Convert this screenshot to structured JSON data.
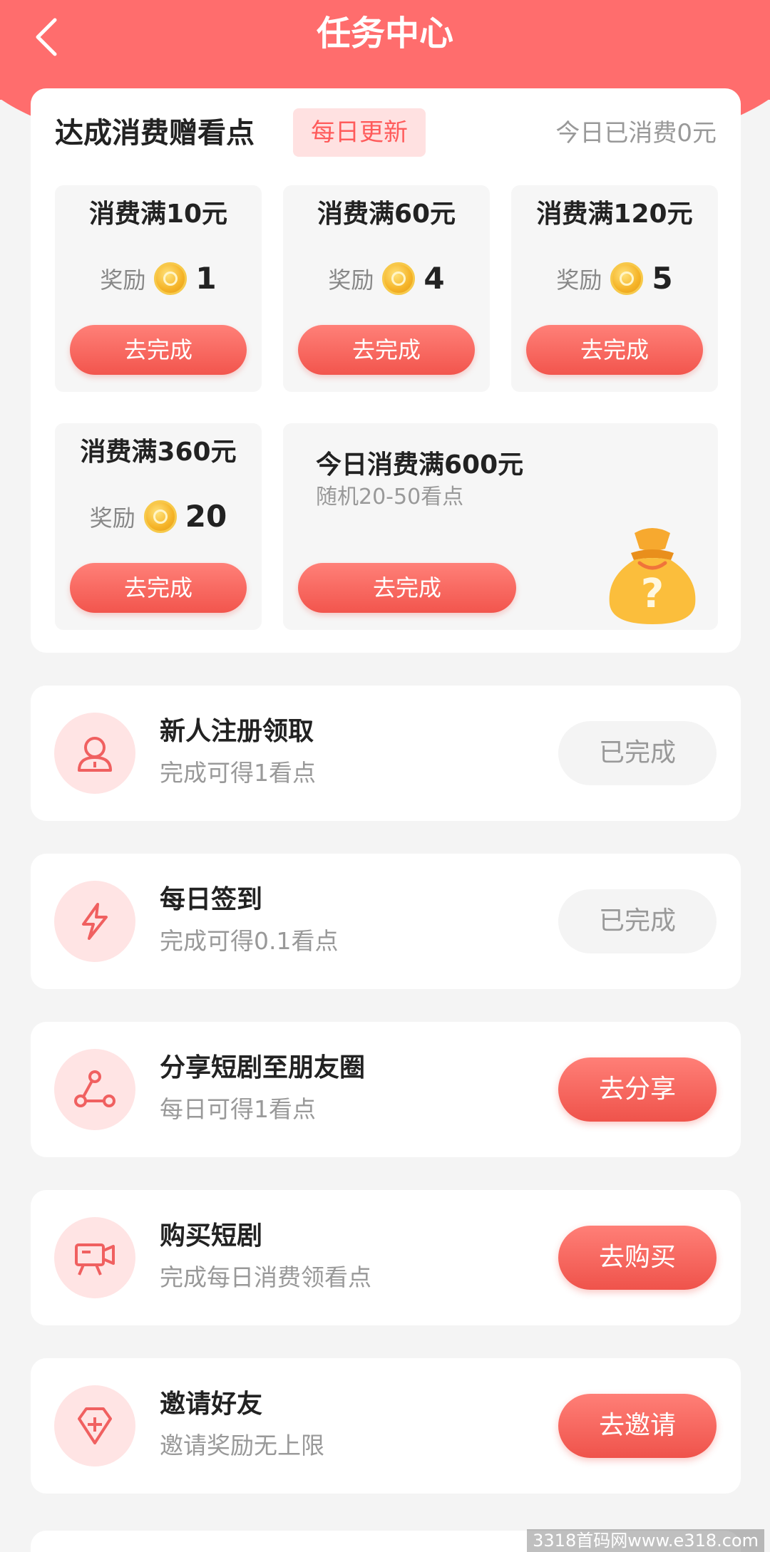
{
  "header": {
    "title": "任务中心"
  },
  "spend_section": {
    "title": "达成消费赠看点",
    "badge": "每日更新",
    "today_spent": "今日已消费0元",
    "reward_label": "奖励",
    "tiers": [
      {
        "title": "消费满10元",
        "reward": "1",
        "button": "去完成"
      },
      {
        "title": "消费满60元",
        "reward": "4",
        "button": "去完成"
      },
      {
        "title": "消费满120元",
        "reward": "5",
        "button": "去完成"
      },
      {
        "title": "消费满360元",
        "reward": "20",
        "button": "去完成"
      }
    ],
    "big_tier": {
      "title": "今日消费满600元",
      "subtitle": "随机20-50看点",
      "button": "去完成"
    }
  },
  "tasks": [
    {
      "title": "新人注册领取",
      "subtitle": "完成可得1看点",
      "button": "已完成",
      "icon": "user-icon",
      "status": "done"
    },
    {
      "title": "每日签到",
      "subtitle": "完成可得0.1看点",
      "button": "已完成",
      "icon": "lightning-icon",
      "status": "done"
    },
    {
      "title": "分享短剧至朋友圈",
      "subtitle": "每日可得1看点",
      "button": "去分享",
      "icon": "share-icon",
      "status": "todo"
    },
    {
      "title": "购买短剧",
      "subtitle": "完成每日消费领看点",
      "button": "去购买",
      "icon": "video-camera-icon",
      "status": "todo"
    },
    {
      "title": "邀请好友",
      "subtitle": "邀请奖励无上限",
      "button": "去邀请",
      "icon": "diamond-plus-icon",
      "status": "todo"
    }
  ],
  "colors": {
    "accent": "#ff6d6d",
    "button": "#f2554d",
    "icon_bg": "#ffe4e4"
  },
  "watermark": "3318首码网www.e318.com"
}
